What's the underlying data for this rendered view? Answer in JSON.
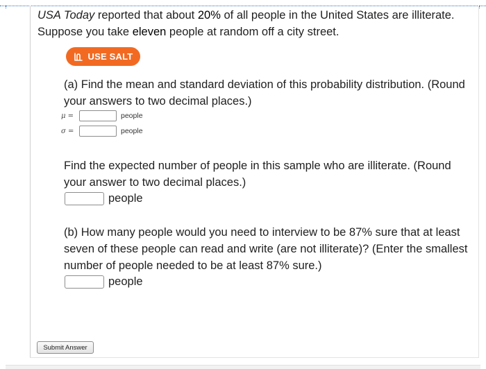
{
  "intro": {
    "source": "USA Today",
    "text_part1": " reported that about ",
    "percent": "20%",
    "text_part2": " of all people in the United States are illiterate. Suppose you take ",
    "n_word": "eleven",
    "text_part3": " people at random off a city street."
  },
  "salt_button": {
    "label": "USE SALT",
    "icon": "salt-icon",
    "color": "#f26a22"
  },
  "part_a": {
    "question": "(a) Find the mean and standard deviation of this probability distribution. (Round your answers to two decimal places.)",
    "mu_label": "μ =",
    "mu_value": "",
    "mu_unit": "people",
    "sigma_label": "σ =",
    "sigma_value": "",
    "sigma_unit": "people",
    "expected_question": "Find the expected number of people in this sample who are illiterate. (Round your answer to two decimal places.)",
    "expected_value": "",
    "expected_unit": "people"
  },
  "part_b": {
    "q_part1": "(b) How many people would you need to interview to be ",
    "pct1": "87%",
    "q_part2": " sure that at least seven of these people can read and write (are not illiterate)? (Enter the smallest number of people needed to be at least ",
    "pct2": "87%",
    "q_part3": " sure.)",
    "value": "",
    "unit": "people"
  },
  "submit": {
    "label": "Submit Answer"
  }
}
